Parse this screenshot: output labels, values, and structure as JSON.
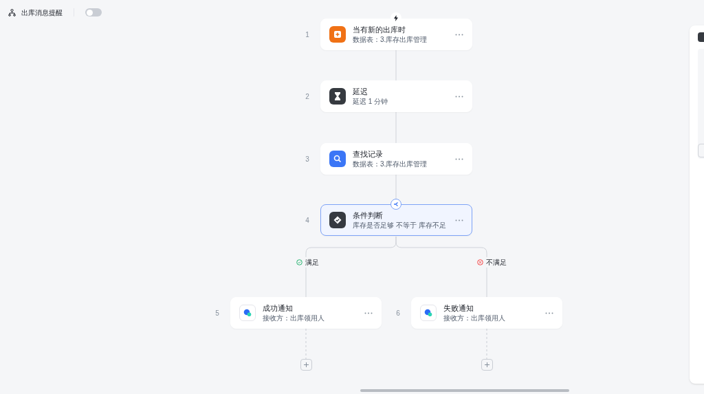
{
  "header": {
    "title": "出库消息提醒",
    "toggle_on": false
  },
  "nodes": [
    {
      "number": "1",
      "title": "当有新的出库时",
      "subtitle": "数据表：3.库存出库管理",
      "kind": "trigger",
      "selected": false
    },
    {
      "number": "2",
      "title": "延迟",
      "subtitle": "延迟 1 分钟",
      "kind": "delay",
      "selected": false
    },
    {
      "number": "3",
      "title": "查找记录",
      "subtitle": "数据表：3.库存出库管理",
      "kind": "search",
      "selected": false
    },
    {
      "number": "4",
      "title": "条件判断",
      "subtitle": "库存是否足够 不等于 库存不足",
      "kind": "condition",
      "selected": true
    }
  ],
  "branches": [
    {
      "label": "满足",
      "kind": "yes",
      "node": {
        "number": "5",
        "title": "成功通知",
        "subtitle": "接收方：出库领用人",
        "kind": "notify",
        "selected": false
      }
    },
    {
      "label": "不满足",
      "kind": "no",
      "node": {
        "number": "6",
        "title": "失败通知",
        "subtitle": "接收方：出库领用人",
        "kind": "notify",
        "selected": false
      }
    }
  ]
}
